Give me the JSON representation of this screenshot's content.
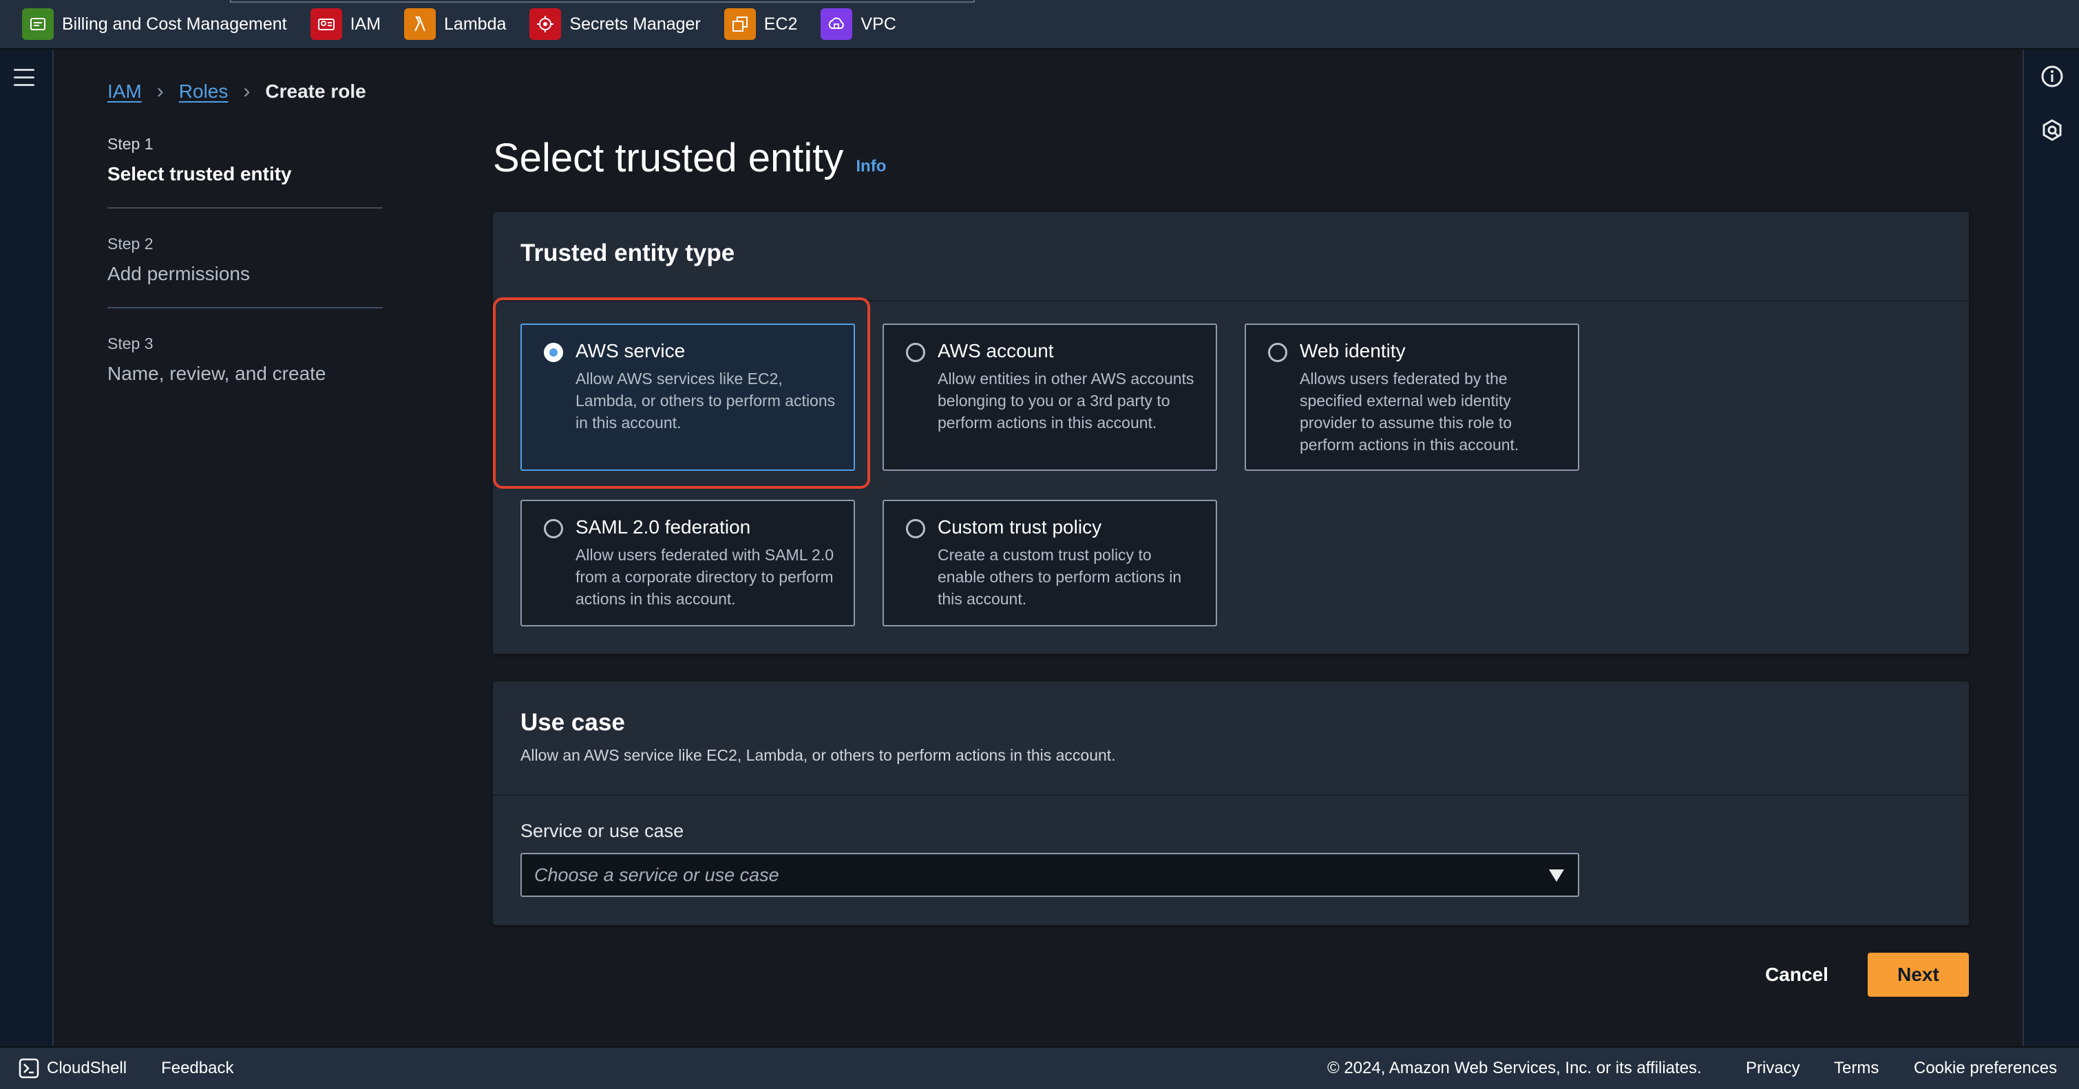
{
  "favorites": [
    {
      "label": "Billing and Cost Management",
      "icon": "billing-icon",
      "color": "#3f8624"
    },
    {
      "label": "IAM",
      "icon": "iam-icon",
      "color": "#c7131f"
    },
    {
      "label": "Lambda",
      "icon": "lambda-icon",
      "color": "#e07b0d"
    },
    {
      "label": "Secrets Manager",
      "icon": "secrets-manager-icon",
      "color": "#c7131f"
    },
    {
      "label": "EC2",
      "icon": "ec2-icon",
      "color": "#e07b0d"
    },
    {
      "label": "VPC",
      "icon": "vpc-icon",
      "color": "#7d3ce8"
    }
  ],
  "breadcrumb": {
    "root": "IAM",
    "parent": "Roles",
    "current": "Create role"
  },
  "steps": [
    {
      "number": "Step 1",
      "title": "Select trusted entity"
    },
    {
      "number": "Step 2",
      "title": "Add permissions"
    },
    {
      "number": "Step 3",
      "title": "Name, review, and create"
    }
  ],
  "page": {
    "title": "Select trusted entity",
    "info": "Info"
  },
  "trusted_entity": {
    "heading": "Trusted entity type",
    "selected": "AWS service",
    "options": [
      {
        "title": "AWS service",
        "desc": "Allow AWS services like EC2, Lambda, or others to perform actions in this account."
      },
      {
        "title": "AWS account",
        "desc": "Allow entities in other AWS accounts belonging to you or a 3rd party to perform actions in this account."
      },
      {
        "title": "Web identity",
        "desc": "Allows users federated by the specified external web identity provider to assume this role to perform actions in this account."
      },
      {
        "title": "SAML 2.0 federation",
        "desc": "Allow users federated with SAML 2.0 from a corporate directory to perform actions in this account."
      },
      {
        "title": "Custom trust policy",
        "desc": "Create a custom trust policy to enable others to perform actions in this account."
      }
    ]
  },
  "use_case": {
    "heading": "Use case",
    "description": "Allow an AWS service like EC2, Lambda, or others to perform actions in this account.",
    "field_label": "Service or use case",
    "placeholder": "Choose a service or use case"
  },
  "actions": {
    "cancel": "Cancel",
    "next": "Next"
  },
  "footer": {
    "cloudshell": "CloudShell",
    "feedback": "Feedback",
    "copyright": "© 2024, Amazon Web Services, Inc. or its affiliates.",
    "privacy": "Privacy",
    "terms": "Terms",
    "cookies": "Cookie preferences"
  },
  "colors": {
    "accent": "#539fe5",
    "primary_button": "#f89d34",
    "highlight": "#e0412b"
  }
}
